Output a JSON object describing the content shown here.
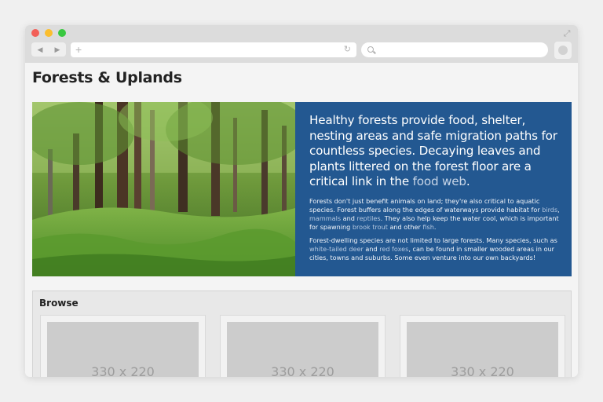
{
  "browser": {
    "nav_back": "◀",
    "nav_forward": "▶",
    "new_tab_icon": "plus-icon",
    "reload_icon": "reload-icon",
    "fullscreen_icon": "expand-icon"
  },
  "page": {
    "title": "Forests & Uplands"
  },
  "hero": {
    "lead_prefix": "Healthy forests provide food, shelter, nesting areas and safe migration paths for countless species. Decaying leaves and plants littered on the forest floor are a critical link in the ",
    "lead_link": "food web",
    "lead_suffix": ".",
    "p1_a": "Forests don't just benefit animals on land; they're also critical to aquatic species. Forest buffers along the edges of waterways provide habitat for ",
    "p1_link_birds": "birds",
    "p1_b": ", ",
    "p1_link_mammals": "mammals",
    "p1_c": " and ",
    "p1_link_reptiles": "reptiles",
    "p1_d": ". They also help keep the water cool, which is important for spawning ",
    "p1_link_trout": "brook trout",
    "p1_e": " and other ",
    "p1_link_fish": "fish",
    "p1_f": ".",
    "p2_a": "Forest-dwelling species are not limited to large forests. Many species, such as ",
    "p2_link_deer": "white-tailed deer",
    "p2_b": " and ",
    "p2_link_foxes": "red foxes",
    "p2_c": ", can be found in smaller wooded areas in our cities, towns and suburbs. Some even venture into our own backyards!",
    "panel_color": "#235891"
  },
  "browse": {
    "title": "Browse",
    "cards": [
      {
        "placeholder": "330 x 220"
      },
      {
        "placeholder": "330 x 220"
      },
      {
        "placeholder": "330 x 220"
      }
    ]
  }
}
